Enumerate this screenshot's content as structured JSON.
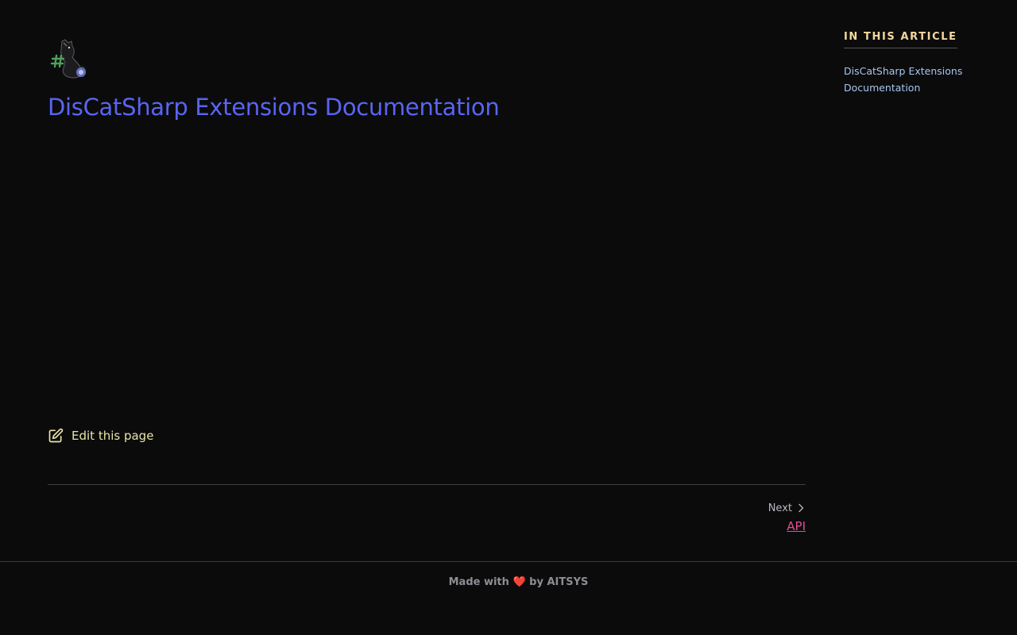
{
  "article": {
    "title": "DisCatSharp Extensions Documentation",
    "edit_label": "Edit this page"
  },
  "pagination": {
    "next_label": "Next",
    "next_link": "API"
  },
  "aside": {
    "heading": "In this article",
    "toc_items": [
      "DisCatSharp Extensions Documentation"
    ]
  },
  "footer": {
    "made_with": "Made with",
    "heart": "❤️",
    "by_text": "by AITSYS"
  },
  "icons": {
    "logo": "discatsharp-logo-icon",
    "edit": "pencil-square-icon",
    "next": "chevron-right-icon"
  },
  "colors": {
    "background": "#0b0b0c",
    "title": "#5865f2",
    "edit_link": "#e7e5a6",
    "next_link": "#e74c94",
    "aside_heading": "#f3d89e",
    "aside_link": "#a7c6ee"
  }
}
